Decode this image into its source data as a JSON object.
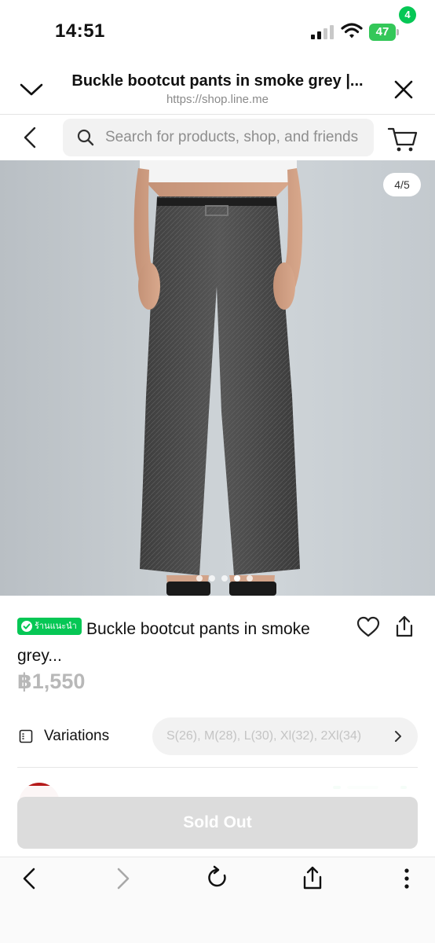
{
  "status_bar": {
    "time": "14:51",
    "battery": "47"
  },
  "browser": {
    "title": "Buckle bootcut pants in smoke grey |...",
    "url": "https://shop.line.me"
  },
  "search": {
    "placeholder": "Search for products, shop, and friends"
  },
  "cart": {
    "count": "4"
  },
  "gallery": {
    "counter": "4/5",
    "total_images": 5,
    "current_index": 4
  },
  "product": {
    "badge": "ร้านแนะนำ",
    "title": "Buckle bootcut pants in smoke grey...",
    "price": "฿1,550"
  },
  "variations": {
    "label": "Variations",
    "options_text": "S(26), M(28), L(30), Xl(32), 2Xl(34)"
  },
  "actions": {
    "sold_out": "Sold Out"
  },
  "colors": {
    "accent_green": "#06c755",
    "disabled_gray": "#dcdcdc",
    "price_gray": "#b8b8b8"
  },
  "icons": {
    "header_left": "chevron-down-icon",
    "header_right": "close-icon",
    "search": "search-icon",
    "cart": "cart-icon",
    "favorite": "heart-icon",
    "share": "share-icon",
    "toolbar": [
      "back-icon",
      "forward-icon",
      "reload-icon",
      "share-icon",
      "more-icon"
    ]
  }
}
